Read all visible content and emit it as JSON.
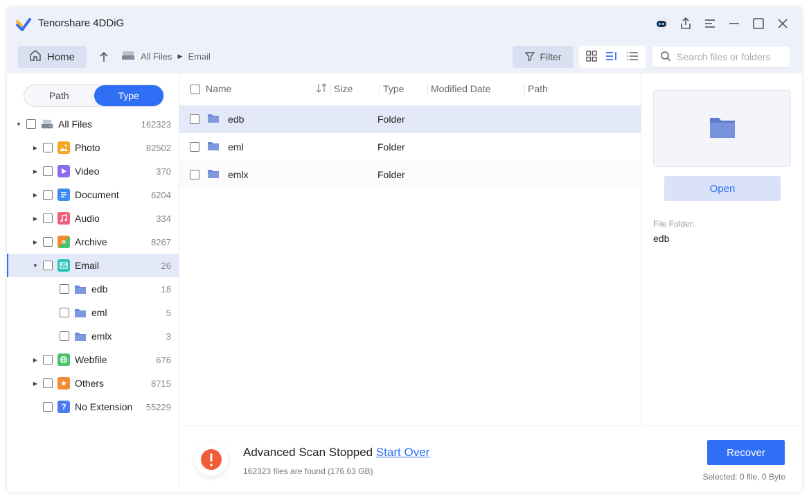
{
  "app": {
    "title": "Tenorshare 4DDiG"
  },
  "toolbar": {
    "home_label": "Home",
    "breadcrumb": [
      "All Files",
      "Email"
    ],
    "filter_label": "Filter",
    "search_placeholder": "Search files or folders"
  },
  "sidebar": {
    "tabs": [
      "Path",
      "Type"
    ],
    "active_tab": "Type",
    "tree": [
      {
        "label": "All Files",
        "count": "162323",
        "level": 0,
        "expanded": true,
        "icon": "drive-icon"
      },
      {
        "label": "Photo",
        "count": "82502",
        "level": 1,
        "expanded": false,
        "icon": "photo-icon",
        "color": "#f5a623"
      },
      {
        "label": "Video",
        "count": "370",
        "level": 1,
        "expanded": false,
        "icon": "video-icon",
        "color": "#8b6cf0"
      },
      {
        "label": "Document",
        "count": "6204",
        "level": 1,
        "expanded": false,
        "icon": "document-icon",
        "color": "#3d8bf2"
      },
      {
        "label": "Audio",
        "count": "334",
        "level": 1,
        "expanded": false,
        "icon": "audio-icon",
        "color": "#f0607a"
      },
      {
        "label": "Archive",
        "count": "8267",
        "level": 1,
        "expanded": false,
        "icon": "archive-icon",
        "color": "#f28b30"
      },
      {
        "label": "Email",
        "count": "26",
        "level": 1,
        "expanded": true,
        "selected": true,
        "icon": "email-icon",
        "color": "#2ec4b6"
      },
      {
        "label": "edb",
        "count": "18",
        "level": 2,
        "icon": "folder-icon"
      },
      {
        "label": "eml",
        "count": "5",
        "level": 2,
        "icon": "folder-icon"
      },
      {
        "label": "emlx",
        "count": "3",
        "level": 2,
        "icon": "folder-icon"
      },
      {
        "label": "Webfile",
        "count": "676",
        "level": 1,
        "expanded": false,
        "icon": "web-icon",
        "color": "#4cc36a"
      },
      {
        "label": "Others",
        "count": "8715",
        "level": 1,
        "expanded": false,
        "icon": "star-icon",
        "color": "#f28b30"
      },
      {
        "label": "No Extension",
        "count": "55229",
        "level": 1,
        "icon": "question-icon",
        "color": "#4a7cf0"
      }
    ]
  },
  "list": {
    "columns": [
      "Name",
      "Size",
      "Type",
      "Modified Date",
      "Path"
    ],
    "rows": [
      {
        "name": "edb",
        "size": "",
        "type": "Folder",
        "modified": "",
        "path": ""
      },
      {
        "name": "eml",
        "size": "",
        "type": "Folder",
        "modified": "",
        "path": ""
      },
      {
        "name": "emlx",
        "size": "",
        "type": "Folder",
        "modified": "",
        "path": ""
      }
    ]
  },
  "preview": {
    "open_label": "Open",
    "meta_label": "File Folder:",
    "meta_value": "edb"
  },
  "status": {
    "title": "Advanced Scan Stopped",
    "link": "Start Over",
    "summary": "162323 files are found (176.63 GB)",
    "recover_label": "Recover",
    "selected_info": "Selected: 0 file, 0 Byte"
  },
  "colors": {
    "accent": "#2f6ef5",
    "folder": "#6b86d4",
    "alert": "#f25c3b"
  }
}
